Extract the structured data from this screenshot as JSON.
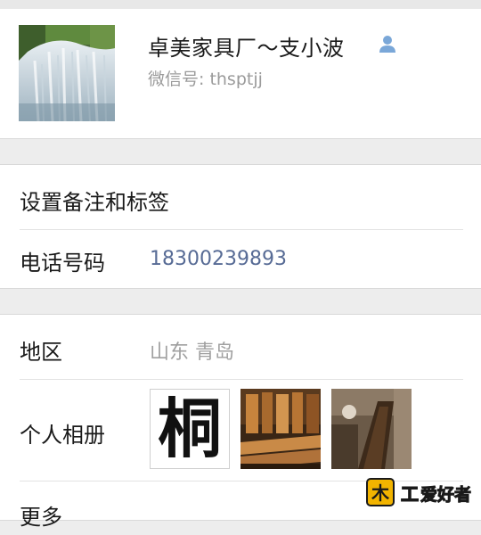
{
  "profile": {
    "name": "卓美家具厂～支小波",
    "wechat_id": "微信号: thsptjj",
    "person_icon": "person-icon"
  },
  "rows": {
    "remark": {
      "label": "设置备注和标签"
    },
    "phone": {
      "label": "电话号码",
      "value": "18300239893"
    },
    "region": {
      "label": "地区",
      "value": "山东  青岛"
    },
    "album": {
      "label": "个人相册",
      "char": "桐"
    },
    "more": {
      "label": "更多"
    }
  },
  "watermark": {
    "text": "木工爱好者"
  },
  "colors": {
    "link": "#576b95",
    "secondary": "#a0a0a0",
    "background": "#ededed",
    "person_icon": "#7aa7d8"
  }
}
